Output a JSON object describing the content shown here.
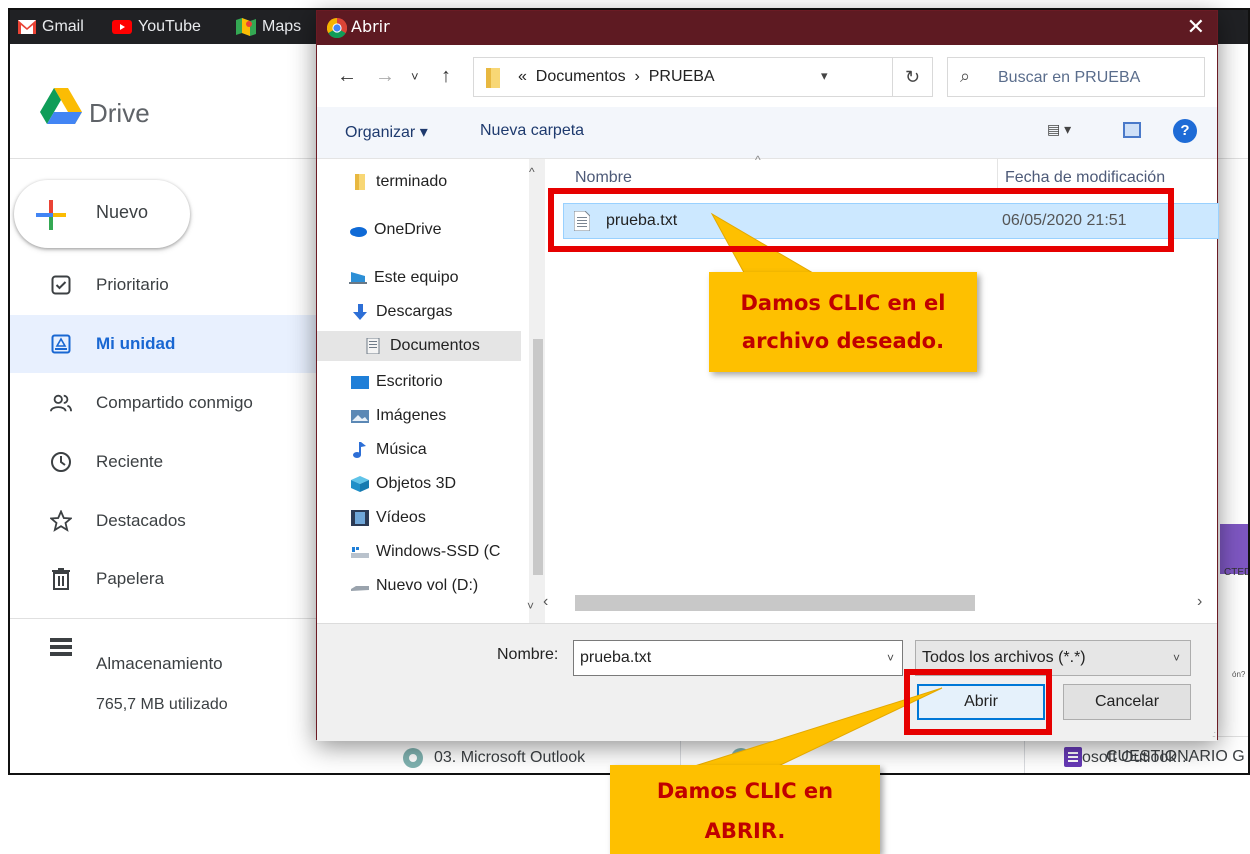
{
  "bookmarks": [
    {
      "label": "Gmail",
      "icon": "gmail-icon"
    },
    {
      "label": "YouTube",
      "icon": "youtube-icon"
    },
    {
      "label": "Maps",
      "icon": "maps-icon"
    }
  ],
  "drive": {
    "title": "Drive",
    "new_label": "Nuevo",
    "nav": [
      {
        "label": "Prioritario",
        "icon": "priority-icon"
      },
      {
        "label": "Mi unidad",
        "icon": "my-drive-icon",
        "active": true
      },
      {
        "label": "Compartido conmigo",
        "icon": "shared-icon"
      },
      {
        "label": "Reciente",
        "icon": "clock-icon"
      },
      {
        "label": "Destacados",
        "icon": "star-icon"
      },
      {
        "label": "Papelera",
        "icon": "trash-icon"
      }
    ],
    "storage_label": "Almacenamiento",
    "storage_used": "765,7 MB utilizado",
    "bottom_items": [
      "03. Microsoft Outlook",
      "osoft Outlook…",
      "CUESTIONARIO G"
    ],
    "right_stub_text": "CTED",
    "right_stub_q": "ón?"
  },
  "dialog": {
    "title": "Abrir",
    "close": "✕",
    "breadcrumb_prefix": "«",
    "breadcrumb": [
      "Documentos",
      "PRUEBA"
    ],
    "breadcrumb_sep": "›",
    "search_placeholder": "Buscar en PRUEBA",
    "organize_label": "Organizar ▾",
    "new_folder_label": "Nueva carpeta",
    "help_label": "?",
    "nav_pane": [
      {
        "label": "terminado",
        "icon": "folder-icon"
      },
      {
        "label": "OneDrive",
        "icon": "onedrive-icon"
      },
      {
        "label": "Este equipo",
        "icon": "computer-icon"
      },
      {
        "label": "Descargas",
        "icon": "download-icon"
      },
      {
        "label": "Documentos",
        "icon": "documents-icon",
        "selected": true
      },
      {
        "label": "Escritorio",
        "icon": "desktop-icon"
      },
      {
        "label": "Imágenes",
        "icon": "pictures-icon"
      },
      {
        "label": "Música",
        "icon": "music-icon"
      },
      {
        "label": "Objetos 3D",
        "icon": "objects-3d-icon"
      },
      {
        "label": "Vídeos",
        "icon": "videos-icon"
      },
      {
        "label": "Windows-SSD (C",
        "icon": "drive-c-icon"
      },
      {
        "label": "Nuevo vol (D:)",
        "icon": "drive-d-icon"
      }
    ],
    "columns": {
      "name": "Nombre",
      "date": "Fecha de modificación"
    },
    "files": [
      {
        "name": "prueba.txt",
        "date": "06/05/2020 21:51",
        "selected": true
      }
    ],
    "filename_label": "Nombre:",
    "filename_value": "prueba.txt",
    "filter_value": "Todos los archivos (*.*)",
    "open_label": "Abrir",
    "cancel_label": "Cancelar"
  },
  "annotations": {
    "callout_1": [
      "Damos CLIC en el",
      "archivo deseado."
    ],
    "callout_2": [
      "Damos CLIC en",
      "ABRIR."
    ]
  },
  "colors": {
    "dialog_titlebar": "#5e1a22",
    "highlight": "#e60000",
    "callout_bg": "#fec000",
    "callout_text": "#c00000",
    "selection": "#cce8ff"
  }
}
